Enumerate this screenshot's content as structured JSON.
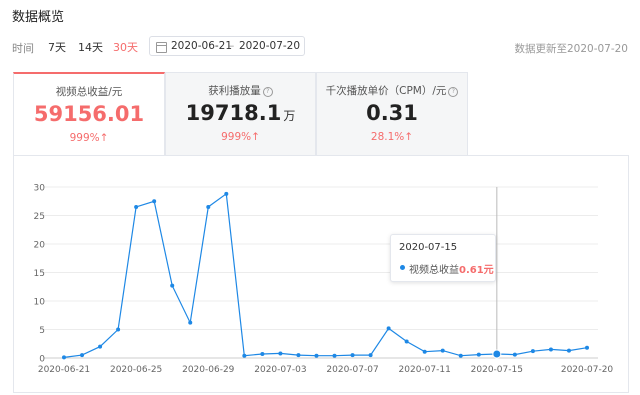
{
  "page": {
    "title": "数据概览",
    "update_text": "数据更新至2020-07-20"
  },
  "filters": {
    "time_label": "时间",
    "ranges": [
      {
        "label": "7天",
        "active": false
      },
      {
        "label": "14天",
        "active": false
      },
      {
        "label": "30天",
        "active": true
      }
    ],
    "date_start": "2020-06-21",
    "date_sep": "–",
    "date_end": "2020-07-20"
  },
  "cards": [
    {
      "label": "视频总收益/元",
      "value": "59156.01",
      "unit": "",
      "change": "999%↑",
      "active": true,
      "help": false
    },
    {
      "label": "获利播放量",
      "value": "19718.1",
      "unit": "万",
      "change": "999%↑",
      "active": false,
      "help": true
    },
    {
      "label": "千次播放单价（CPM）/元",
      "value": "0.31",
      "unit": "",
      "change": "28.1%↑",
      "active": false,
      "help": true
    }
  ],
  "tooltip": {
    "date": "2020-07-15",
    "series_name": "视频总收益",
    "value": "0.61元"
  },
  "colors": {
    "accent": "#f56c6c",
    "line": "#1e88e5"
  },
  "chart_data": {
    "type": "line",
    "title": "",
    "xlabel": "",
    "ylabel": "",
    "ylim": [
      0,
      30
    ],
    "yticks": [
      0,
      5,
      10,
      15,
      20,
      25,
      30
    ],
    "grid": true,
    "x": [
      "2020-06-21",
      "2020-06-22",
      "2020-06-23",
      "2020-06-24",
      "2020-06-25",
      "2020-06-26",
      "2020-06-27",
      "2020-06-28",
      "2020-06-29",
      "2020-06-30",
      "2020-07-01",
      "2020-07-02",
      "2020-07-03",
      "2020-07-04",
      "2020-07-05",
      "2020-07-06",
      "2020-07-07",
      "2020-07-08",
      "2020-07-09",
      "2020-07-10",
      "2020-07-11",
      "2020-07-12",
      "2020-07-13",
      "2020-07-14",
      "2020-07-15",
      "2020-07-16",
      "2020-07-17",
      "2020-07-18",
      "2020-07-19",
      "2020-07-20"
    ],
    "xtick_labels": [
      "2020-06-21",
      "2020-06-25",
      "2020-06-29",
      "2020-07-03",
      "2020-07-07",
      "2020-07-11",
      "2020-07-15",
      "2020-07-20"
    ],
    "series": [
      {
        "name": "视频总收益",
        "values": [
          0.1,
          0.5,
          2.0,
          5.0,
          26.5,
          27.5,
          12.7,
          6.2,
          26.5,
          28.8,
          0.4,
          0.7,
          0.8,
          0.5,
          0.4,
          0.4,
          0.5,
          0.5,
          5.2,
          2.9,
          1.1,
          1.3,
          0.4,
          0.6,
          0.7,
          0.6,
          1.2,
          1.5,
          1.3,
          1.8
        ]
      }
    ],
    "highlight_x": "2020-07-15"
  }
}
